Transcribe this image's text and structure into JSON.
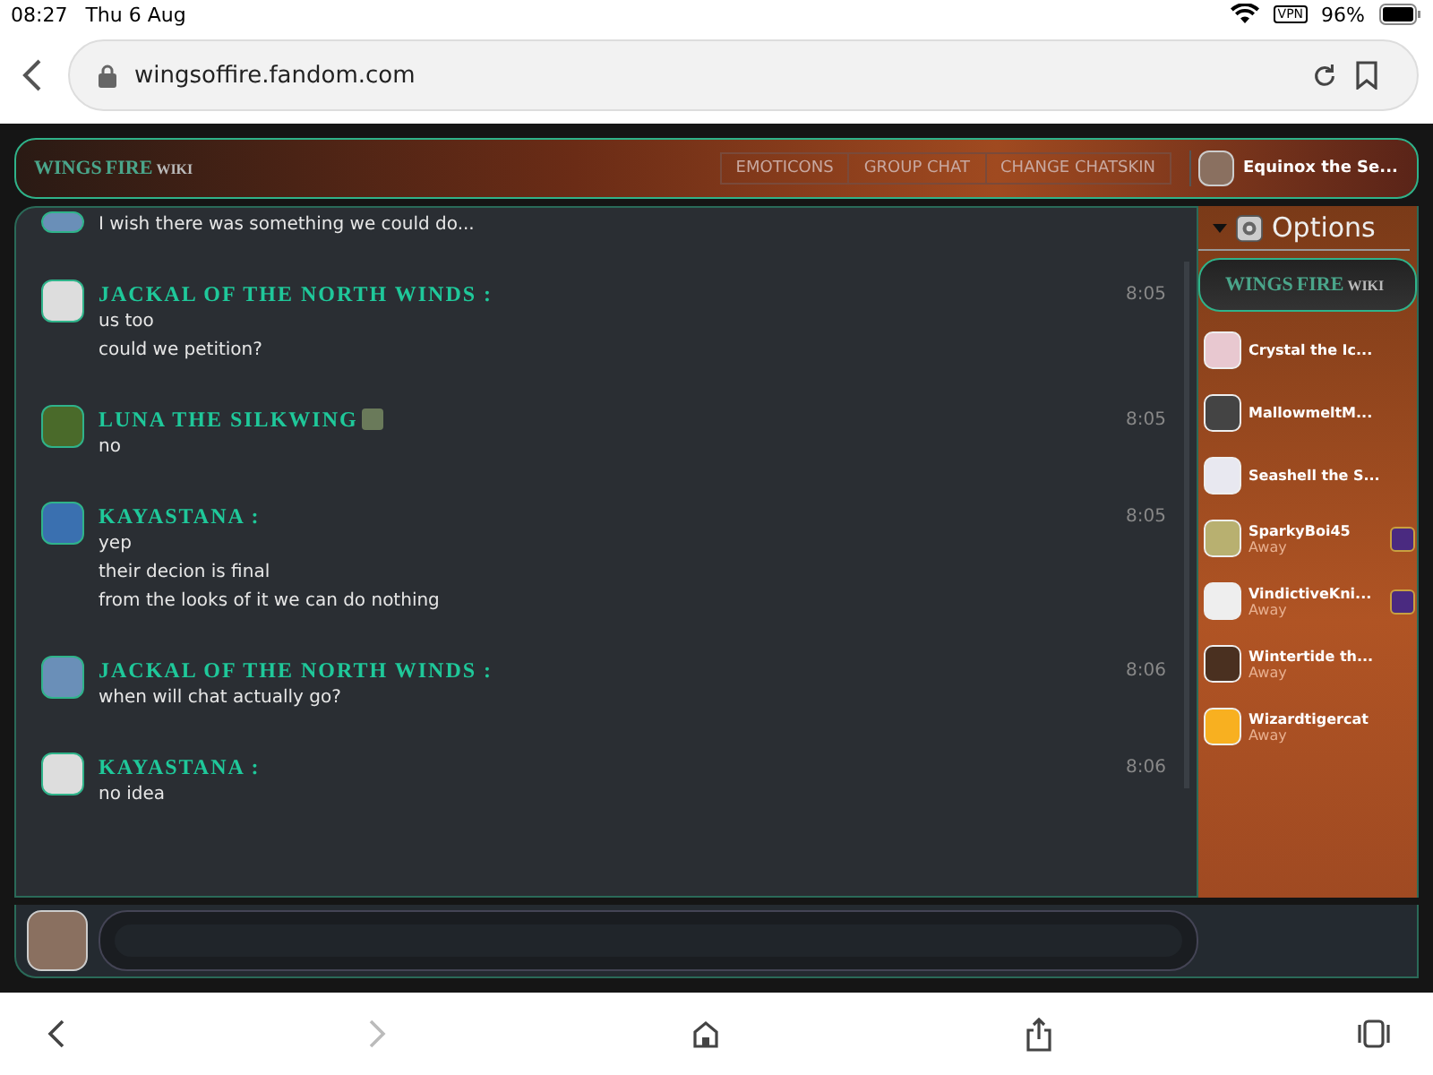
{
  "status_bar": {
    "time": "08:27",
    "date": "Thu 6 Aug",
    "vpn": "VPN",
    "battery": "96%"
  },
  "browser": {
    "url": "wingsoffire.fandom.com"
  },
  "header": {
    "logo_top": "WINGS",
    "logo_bottom": "FIRE",
    "logo_wiki": "WIKI",
    "buttons": [
      "EMOTICONS",
      "GROUP CHAT",
      "CHANGE CHATSKIN"
    ],
    "user": "Equinox the Se..."
  },
  "messages": [
    {
      "lines": [
        "I wish there was something we could do..."
      ]
    },
    {
      "author": "JACKAL OF THE NORTH WINDS :",
      "time": "8:05",
      "lines": [
        "us too",
        "could we petition?"
      ]
    },
    {
      "author": "LUNA THE SILKWING",
      "badge": true,
      "time": "8:05",
      "lines": [
        "no"
      ]
    },
    {
      "author": "KAYASTANA :",
      "time": "8:05",
      "lines": [
        "yep",
        "their decion is final",
        "from the looks of it we can do nothing"
      ]
    },
    {
      "author": "JACKAL OF THE NORTH WINDS :",
      "time": "8:06",
      "lines": [
        "when will chat actually go?"
      ]
    },
    {
      "author": "KAYASTANA :",
      "time": "8:06",
      "lines": [
        "no idea"
      ]
    }
  ],
  "sidebar": {
    "options": "Options",
    "logo_top": "WINGS",
    "logo_bottom": "FIRE",
    "logo_wiki": "WIKI",
    "users": [
      {
        "name": "Crystal the Ic..."
      },
      {
        "name": "MallowmeltM..."
      },
      {
        "name": "Seashell the S..."
      },
      {
        "name": "SparkyBoi45",
        "status": "Away",
        "badge": true
      },
      {
        "name": "VindictiveKni...",
        "status": "Away",
        "badge": true
      },
      {
        "name": "Wintertide th...",
        "status": "Away"
      },
      {
        "name": "Wizardtigercat",
        "status": "Away"
      }
    ]
  }
}
